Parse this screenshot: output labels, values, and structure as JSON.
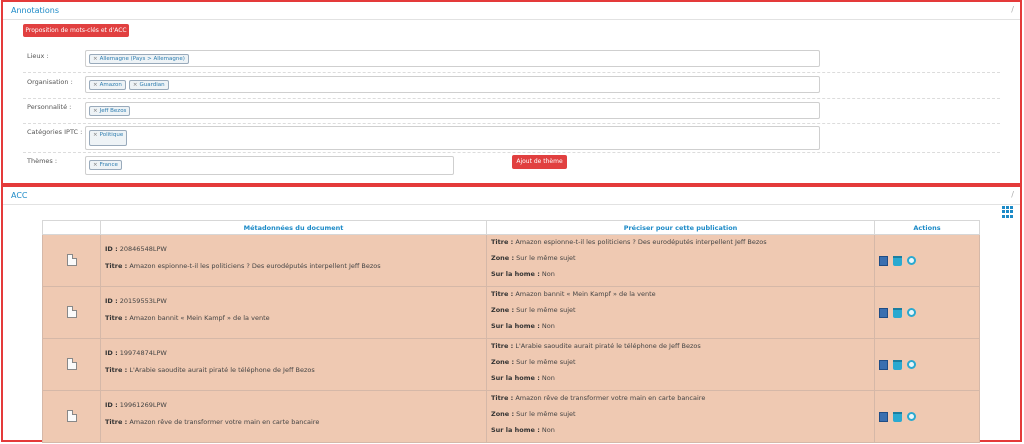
{
  "annotations": {
    "title": "Annotations",
    "collapse": "/",
    "propose_button": "Proposition de mots-clés et d'ACC",
    "add_theme_button": "Ajout de thème",
    "fields": [
      {
        "label": "Lieux :",
        "tags": [
          "Allemagne (Pays > Allemagne)"
        ]
      },
      {
        "label": "Organisation :",
        "tags": [
          "Amazon",
          "Guardian"
        ]
      },
      {
        "label": "Personnalité :",
        "tags": [
          "Jeff Bezos"
        ]
      },
      {
        "label": "Catégories IPTC :",
        "tags": [
          "Politique"
        ]
      },
      {
        "label": "Thèmes :",
        "tags": [
          "France"
        ]
      }
    ],
    "tag_remove": "×"
  },
  "acc": {
    "title": "ACC",
    "collapse": "/",
    "headers": {
      "meta": "Métadonnées du document",
      "pub": "Préciser pour cette publication",
      "actions": "Actions"
    },
    "labels": {
      "id": "ID :",
      "titre": "Titre :",
      "zone": "Zone :",
      "home": "Sur la home :"
    },
    "rows": [
      {
        "id": "20846548LPW",
        "titre": "Amazon espionne-t-il les politiciens ? Des eurodéputés interpellent Jeff Bezos",
        "pub_titre": "Amazon espionne-t-il les politiciens ? Des eurodéputés interpellent Jeff Bezos",
        "zone": "Sur le même sujet",
        "home": "Non"
      },
      {
        "id": "20159553LPW",
        "titre": "Amazon bannit « Mein Kampf » de la vente",
        "pub_titre": "Amazon bannit « Mein Kampf » de la vente",
        "zone": "Sur le même sujet",
        "home": "Non"
      },
      {
        "id": "19974874LPW",
        "titre": "L'Arabie saoudite aurait piraté le téléphone de Jeff Bezos",
        "pub_titre": "L'Arabie saoudite aurait piraté le téléphone de Jeff Bezos",
        "zone": "Sur le même sujet",
        "home": "Non"
      },
      {
        "id": "19961269LPW",
        "titre": "Amazon rêve de transformer votre main en carte bancaire",
        "pub_titre": "Amazon rêve de transformer votre main en carte bancaire",
        "zone": "Sur le même sujet",
        "home": "Non"
      }
    ]
  }
}
